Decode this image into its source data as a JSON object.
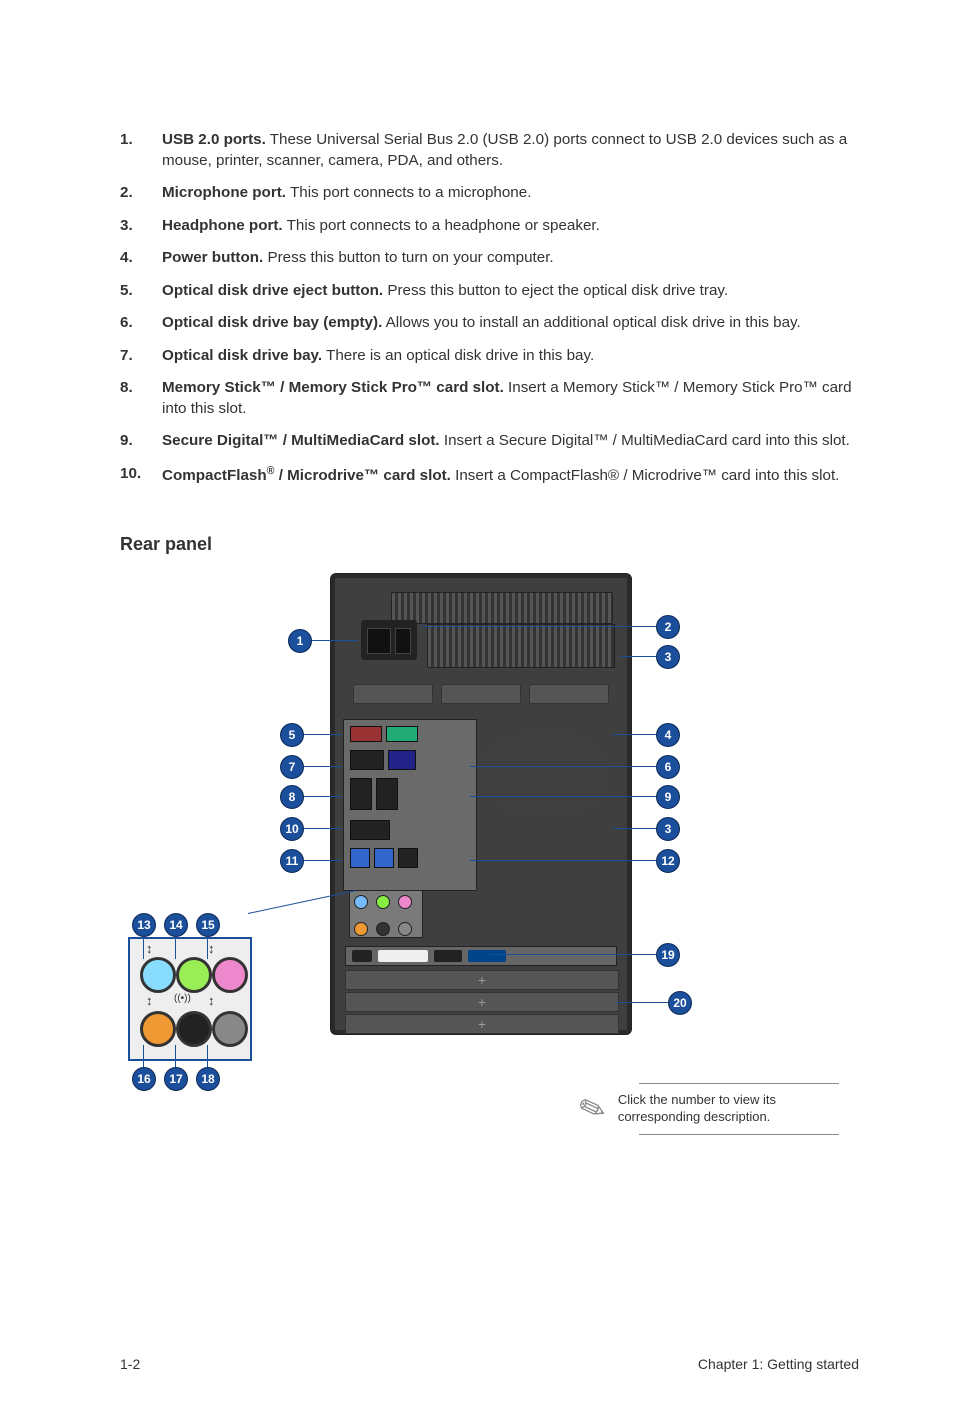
{
  "list": [
    {
      "num": "1.",
      "bold": "USB 2.0 ports.",
      "text": " These Universal Serial Bus 2.0 (USB 2.0) ports connect to USB 2.0 devices such as a mouse, printer, scanner, camera, PDA, and others."
    },
    {
      "num": "2.",
      "bold": "Microphone port.",
      "text": " This port connects to a microphone."
    },
    {
      "num": "3.",
      "bold": "Headphone port.",
      "text": " This port connects to a headphone or speaker."
    },
    {
      "num": "4.",
      "bold": "Power button.",
      "text": " Press this button to turn on your computer."
    },
    {
      "num": "5.",
      "bold": "Optical disk drive eject button.",
      "text": " Press this button to eject the optical disk drive tray."
    },
    {
      "num": "6.",
      "bold": "Optical disk drive bay (empty).",
      "text": " Allows you to install an additional optical disk drive in this bay."
    },
    {
      "num": "7.",
      "bold": "Optical disk drive bay.",
      "text": " There is an optical disk drive in this bay."
    },
    {
      "num": "8.",
      "bold": "Memory Stick™ / Memory Stick Pro™ card slot.",
      "text": " Insert a Memory Stick™ / Memory Stick Pro™ card into this slot."
    },
    {
      "num": "9.",
      "bold": "Secure Digital™ / MultiMediaCard slot.",
      "text": " Insert a Secure Digital™ / MultiMediaCard card into this slot."
    },
    {
      "num": "10.",
      "bold": "CompactFlash® / Microdrive™ card slot.",
      "text_html": " Insert a CompactFlash® / Microdrive™ card into this slot."
    }
  ],
  "section_title": "Rear panel",
  "callouts": {
    "c1": "1",
    "c2": "2",
    "c3": "3",
    "c4": "4",
    "c5": "5",
    "c6": "6",
    "c7": "7",
    "c8": "8",
    "c9": "9",
    "c10": "10",
    "c11": "11",
    "c12": "12",
    "c3b": "3",
    "c13": "13",
    "c14": "14",
    "c15": "15",
    "c16": "16",
    "c17": "17",
    "c18": "18",
    "c19": "19",
    "c20": "20"
  },
  "note": "Click the number to view its corresponding description.",
  "footer_left": "1-2",
  "footer_right": "Chapter 1: Getting started"
}
